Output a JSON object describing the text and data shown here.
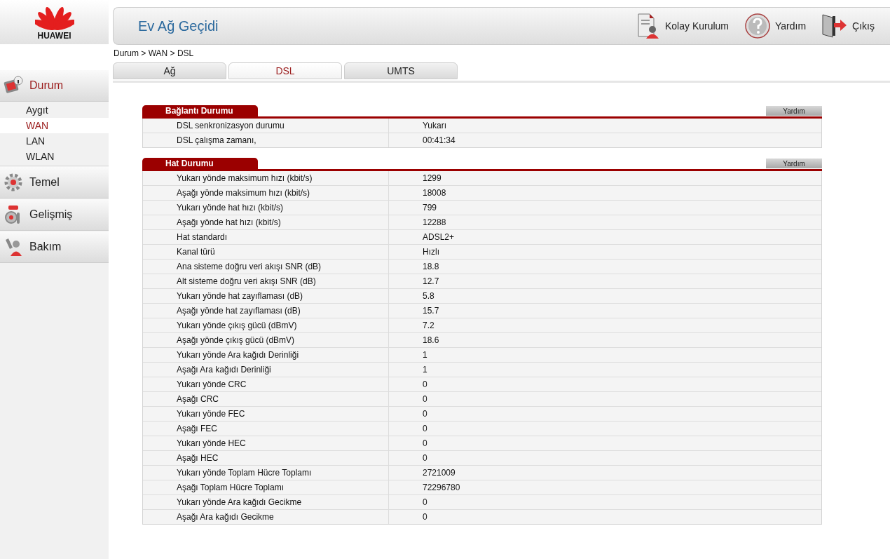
{
  "logo": {
    "text": "HUAWEI"
  },
  "header": {
    "title": "Ev Ağ Geçidi",
    "actions": [
      {
        "kind": "setup",
        "label": "Kolay Kurulum"
      },
      {
        "kind": "help",
        "label": "Yardım"
      },
      {
        "kind": "exit",
        "label": "Çıkış"
      }
    ]
  },
  "sidebar": {
    "items": [
      {
        "kind": "status",
        "label": "Durum",
        "selected": true,
        "children": [
          {
            "label": "Aygıt",
            "selected": false
          },
          {
            "label": "WAN",
            "selected": true
          },
          {
            "label": "LAN",
            "selected": false
          },
          {
            "label": "WLAN",
            "selected": false
          }
        ]
      },
      {
        "kind": "basic",
        "label": "Temel",
        "selected": false
      },
      {
        "kind": "advanced",
        "label": "Gelişmiş",
        "selected": false
      },
      {
        "kind": "maintenance",
        "label": "Bakım",
        "selected": false
      }
    ]
  },
  "breadcrumb": "Durum > WAN > DSL",
  "tabs": [
    {
      "label": "Ağ",
      "selected": false
    },
    {
      "label": "DSL",
      "selected": true
    },
    {
      "label": "UMTS",
      "selected": false
    }
  ],
  "sections": [
    {
      "title": "Bağlantı Durumu",
      "help": "Yardım",
      "rows": [
        [
          "DSL senkronizasyon durumu",
          "Yukarı"
        ],
        [
          "DSL çalışma zamanı,",
          "00:41:34"
        ]
      ]
    },
    {
      "title": "Hat Durumu",
      "help": "Yardım",
      "rows": [
        [
          "Yukarı yönde maksimum hızı (kbit/s)",
          "1299"
        ],
        [
          "Aşağı yönde maksimum hızı (kbit/s)",
          "18008"
        ],
        [
          "Yukarı yönde hat hızı (kbit/s)",
          "799"
        ],
        [
          "Aşağı yönde hat hızı (kbit/s)",
          "12288"
        ],
        [
          "Hat standardı",
          "ADSL2+"
        ],
        [
          "Kanal türü",
          "Hızlı"
        ],
        [
          "Ana sisteme doğru veri akışı SNR (dB)",
          "18.8"
        ],
        [
          "Alt sisteme doğru veri akışı SNR (dB)",
          "12.7"
        ],
        [
          "Yukarı yönde hat zayıflaması (dB)",
          "5.8"
        ],
        [
          "Aşağı yönde hat zayıflaması (dB)",
          "15.7"
        ],
        [
          "Yukarı yönde çıkış gücü (dBmV)",
          "7.2"
        ],
        [
          "Aşağı yönde çıkış gücü (dBmV)",
          "18.6"
        ],
        [
          "Yukarı yönde Ara kağıdı Derinliği",
          "1"
        ],
        [
          "Aşağı Ara kağıdı Derinliği",
          "1"
        ],
        [
          "Yukarı yönde CRC",
          "0"
        ],
        [
          "Aşağı CRC",
          "0"
        ],
        [
          "Yukarı yönde FEC",
          "0"
        ],
        [
          "Aşağı FEC",
          "0"
        ],
        [
          "Yukarı yönde HEC",
          "0"
        ],
        [
          "Aşağı HEC",
          "0"
        ],
        [
          "Yukarı yönde Toplam Hücre Toplamı",
          "2721009"
        ],
        [
          "Aşağı Toplam Hücre Toplamı",
          "72296780"
        ],
        [
          "Yukarı yönde Ara kağıdı Gecikme",
          "0"
        ],
        [
          "Aşağı Ara kağıdı Gecikme",
          "0"
        ]
      ]
    }
  ]
}
